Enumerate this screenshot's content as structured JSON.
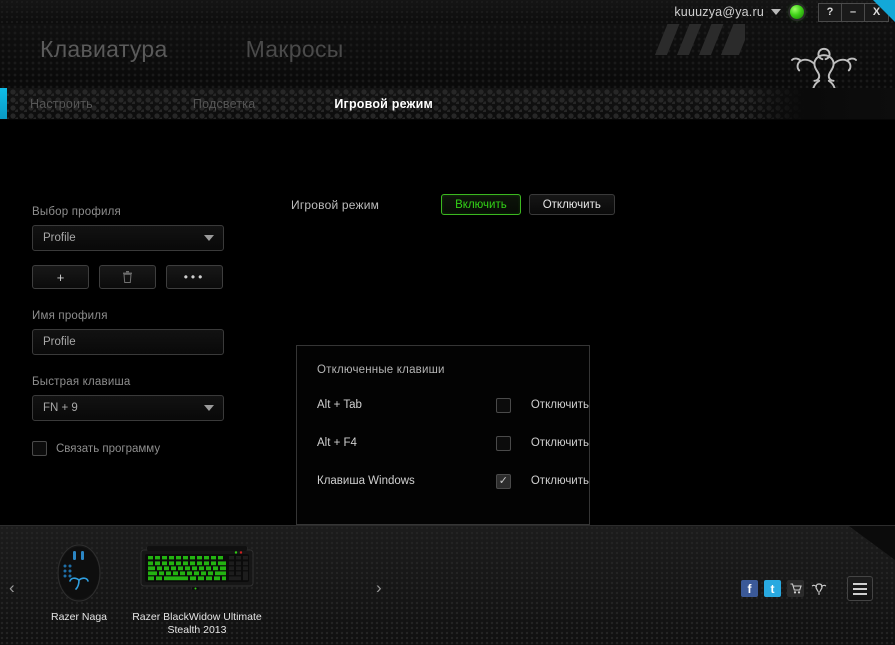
{
  "titlebar": {
    "user_email": "kuuuzya@ya.ru",
    "dropdown_icon": "chevron-down-icon",
    "status_icon": "online-status-dot",
    "help_label": "?",
    "minimize_label": "–",
    "close_label": "X"
  },
  "header": {
    "logo_icon": "razer-logo",
    "main_tabs": [
      {
        "label": "Клавиатура",
        "active": true
      },
      {
        "label": "Макросы",
        "active": false
      }
    ],
    "sub_tabs": [
      {
        "label": "Настроить",
        "active": false
      },
      {
        "label": "Подсветка",
        "active": false
      },
      {
        "label": "Игровой режим",
        "active": true
      }
    ],
    "accent_color": "#0fbde8"
  },
  "profile_panel": {
    "select_label": "Выбор профиля",
    "select_value": "Profile",
    "add_label": "+",
    "delete_label": "delete",
    "more_label": "•••",
    "name_label": "Имя профиля",
    "name_value": "Profile",
    "hotkey_label": "Быстрая клавиша",
    "hotkey_value": "FN + 9",
    "link_program_label": "Связать программу",
    "link_program_checked": false
  },
  "game_mode": {
    "title": "Игровой режим",
    "enable_label": "Включить",
    "disable_label": "Отключить",
    "enabled": true,
    "enabled_color": "#33d317",
    "panel_title": "Отключенные клавиши",
    "rows": [
      {
        "key": "Alt + Tab",
        "action": "Отключить",
        "checked": false
      },
      {
        "key": "Alt + F4",
        "action": "Отключить",
        "checked": false
      },
      {
        "key": "Клавиша Windows",
        "action": "Отключить",
        "checked": true
      }
    ]
  },
  "device_bar": {
    "prev_label": "‹",
    "next_label": "›",
    "devices": [
      {
        "name": "Razer Naga",
        "icon": "mouse-device-thumbnail"
      },
      {
        "name": "Razer BlackWidow Ultimate Stealth 2013",
        "icon": "keyboard-device-thumbnail"
      }
    ],
    "social": [
      {
        "name": "facebook-icon",
        "label": "f"
      },
      {
        "name": "twitter-icon",
        "label": "t"
      },
      {
        "name": "cart-icon",
        "label": "🛒"
      },
      {
        "name": "razer-icon",
        "label": ""
      }
    ],
    "menu_icon": "hamburger-menu-icon"
  }
}
